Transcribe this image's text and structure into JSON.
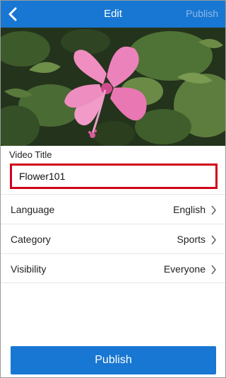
{
  "header": {
    "title": "Edit",
    "back_icon": "chevron-left-icon",
    "publish_label": "Publish"
  },
  "media": {
    "subject": "pink hibiscus flower"
  },
  "form": {
    "title_label": "Video Title",
    "title_value": "Flower101",
    "rows": [
      {
        "label": "Language",
        "value": "English",
        "icon": "chevron-right-icon"
      },
      {
        "label": "Category",
        "value": "Sports",
        "icon": "chevron-right-icon"
      },
      {
        "label": "Visibility",
        "value": "Everyone",
        "icon": "chevron-right-icon"
      }
    ]
  },
  "footer": {
    "publish_label": "Publish"
  },
  "colors": {
    "accent": "#1877d2",
    "highlight_border": "#d0021b",
    "disabled_publish": "#8fb8e6"
  }
}
